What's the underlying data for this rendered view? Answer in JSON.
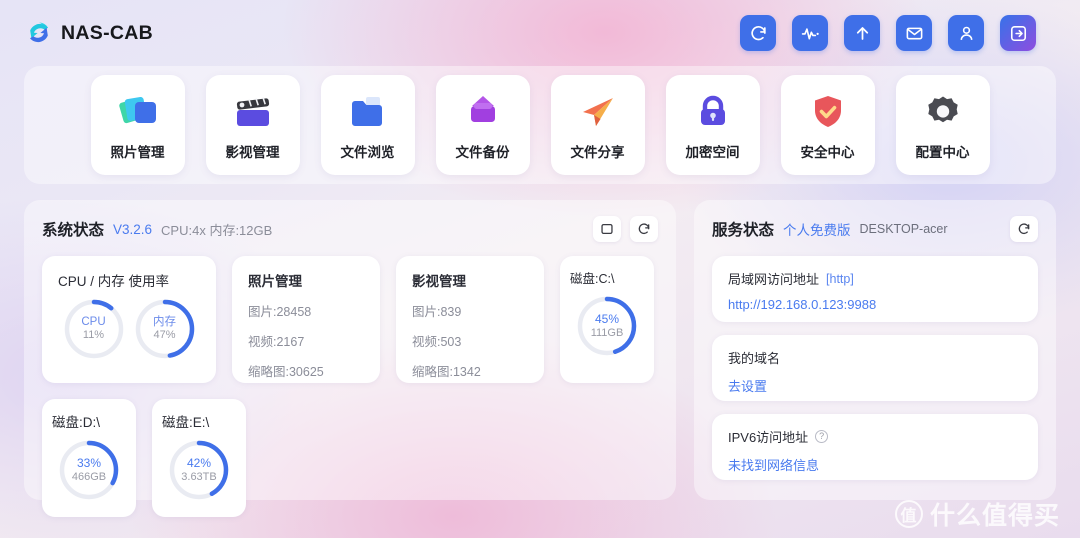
{
  "brand": {
    "name": "NAS-CAB",
    "logo_icon": "nas-cab-logo-icon"
  },
  "topbar": {
    "actions": [
      {
        "name": "refresh-icon",
        "label": "refresh"
      },
      {
        "name": "activity-icon",
        "label": "activity"
      },
      {
        "name": "upload-icon",
        "label": "upload"
      },
      {
        "name": "mail-icon",
        "label": "mail"
      },
      {
        "name": "user-icon",
        "label": "user"
      },
      {
        "name": "logout-icon",
        "label": "logout"
      }
    ]
  },
  "apps": [
    {
      "label": "照片管理",
      "icon": "photos-icon"
    },
    {
      "label": "影视管理",
      "icon": "video-clapperboard-icon"
    },
    {
      "label": "文件浏览",
      "icon": "folder-icon"
    },
    {
      "label": "文件备份",
      "icon": "backup-icon"
    },
    {
      "label": "文件分享",
      "icon": "share-paperplane-icon"
    },
    {
      "label": "加密空间",
      "icon": "lock-icon"
    },
    {
      "label": "安全中心",
      "icon": "shield-check-icon"
    },
    {
      "label": "配置中心",
      "icon": "gear-icon"
    }
  ],
  "system_status": {
    "title": "系统状态",
    "version": "V3.2.6",
    "specs": "CPU:4x 内存:12GB",
    "actions": [
      {
        "name": "monitor-icon",
        "label": "display"
      },
      {
        "name": "refresh-icon",
        "label": "refresh"
      }
    ],
    "usage_card": {
      "title": "CPU / 内存 使用率",
      "rings": [
        {
          "name": "CPU",
          "value": "11%",
          "percent": 11
        },
        {
          "name": "内存",
          "value": "47%",
          "percent": 47
        }
      ]
    },
    "photo_card": {
      "title": "照片管理",
      "lines": [
        "图片:28458",
        "视频:2167",
        "缩略图:30625"
      ]
    },
    "video_card": {
      "title": "影视管理",
      "lines": [
        "图片:839",
        "视频:503",
        "缩略图:1342"
      ]
    },
    "disks": [
      {
        "title": "磁盘:C:\\",
        "percent": 45,
        "pct_label": "45%",
        "size": "111GB"
      },
      {
        "title": "磁盘:D:\\",
        "percent": 33,
        "pct_label": "33%",
        "size": "466GB"
      },
      {
        "title": "磁盘:E:\\",
        "percent": 42,
        "pct_label": "42%",
        "size": "3.63TB"
      }
    ]
  },
  "service_status": {
    "title": "服务状态",
    "edition": "个人免费版",
    "hostname": "DESKTOP-acer",
    "refresh_icon": "refresh-icon",
    "cards": [
      {
        "label": "局域网访问地址",
        "tag": "[http]",
        "value": "http://192.168.0.123:9988",
        "help": false
      },
      {
        "label": "我的域名",
        "tag": "",
        "value": "去设置",
        "help": false
      },
      {
        "label": "IPV6访问地址",
        "tag": "",
        "value": "未找到网络信息",
        "help": true,
        "help_glyph": "?"
      }
    ]
  },
  "watermark": {
    "badge": "值",
    "text": "什么值得买"
  },
  "colors": {
    "accent_blue": "#3f6fe8",
    "link_blue": "#4a7bef",
    "ring_track": "#e9ebf2",
    "purple": "#8a4fe0",
    "danger_red": "#e8565b"
  }
}
